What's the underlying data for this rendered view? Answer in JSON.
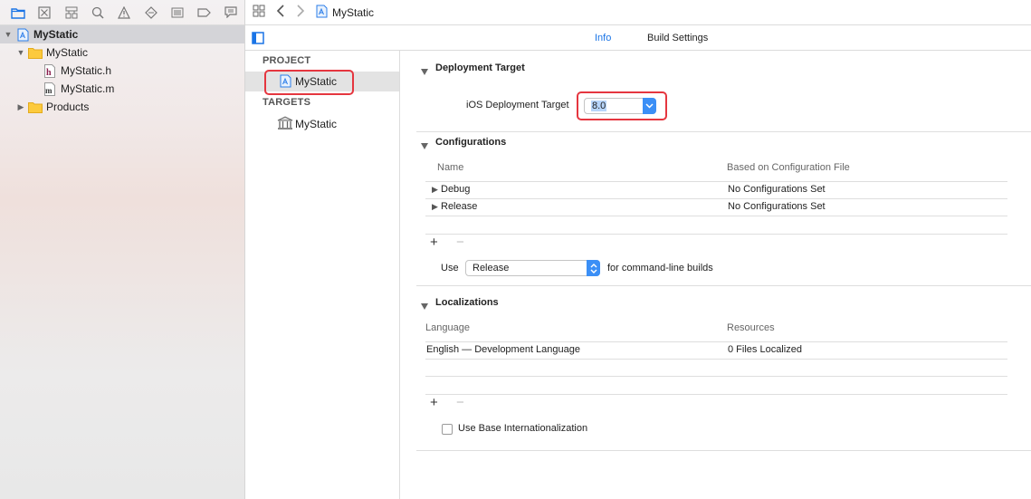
{
  "navigator": {
    "toolbar_icons": [
      "folder-icon",
      "source-control-icon",
      "symbol-icon",
      "find-icon",
      "issue-icon",
      "test-icon",
      "debug-icon",
      "breakpoint-icon",
      "report-icon"
    ],
    "tree": [
      {
        "label": "MyStatic",
        "icon": "project-icon",
        "bold": true,
        "selected": true
      },
      {
        "label": "MyStatic",
        "icon": "folder-icon"
      },
      {
        "label": "MyStatic.h",
        "icon": "header-file-icon"
      },
      {
        "label": "MyStatic.m",
        "icon": "source-file-icon"
      },
      {
        "label": "Products",
        "icon": "folder-icon"
      }
    ]
  },
  "jumpbar": {
    "title": "MyStatic"
  },
  "tabs": {
    "info": "Info",
    "build_settings": "Build Settings"
  },
  "project_list": {
    "project_header": "PROJECT",
    "project_item": "MyStatic",
    "targets_header": "TARGETS",
    "target_item": "MyStatic"
  },
  "deployment": {
    "title": "Deployment Target",
    "label": "iOS Deployment Target",
    "value": "8.0"
  },
  "configurations": {
    "title": "Configurations",
    "col_name": "Name",
    "col_file": "Based on Configuration File",
    "rows": [
      {
        "name": "Debug",
        "file": "No Configurations Set"
      },
      {
        "name": "Release",
        "file": "No Configurations Set"
      }
    ],
    "add": "+",
    "remove": "−",
    "use_label": "Use",
    "use_value": "Release",
    "use_suffix": "for command-line builds"
  },
  "localizations": {
    "title": "Localizations",
    "col_language": "Language",
    "col_resources": "Resources",
    "rows": [
      {
        "language": "English — Development Language",
        "resources": "0 Files Localized"
      }
    ],
    "add": "+",
    "remove": "−",
    "base_intl_label": "Use Base Internationalization",
    "base_intl_checked": false
  },
  "colors": {
    "accent": "#3b8ff6",
    "highlight": "#e5363f",
    "selection": "#d4d4d8"
  }
}
